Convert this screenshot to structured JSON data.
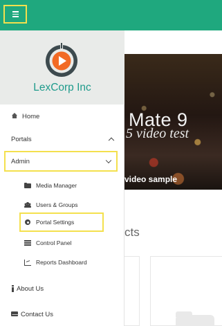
{
  "header": {
    "menu_button": "menu-hamburger-icon",
    "background_color": "#1fa87e"
  },
  "background": {
    "hero_line1": "Mate 9",
    "hero_line2": "5 video test",
    "hero_caption": "video sample",
    "section_title": "cts"
  },
  "drawer": {
    "brand_name": "LexCorp Inc",
    "brand_color": "#1f9b8c",
    "highlight_color": "#f4e04d",
    "items": [
      {
        "label": "Home",
        "icon": "home-icon"
      },
      {
        "label": "Portals",
        "icon": "chevron-up-icon"
      },
      {
        "label": "Admin",
        "icon": "chevron-down-icon"
      },
      {
        "label": "Media Manager",
        "icon": "folder-icon"
      },
      {
        "label": "Users & Groups",
        "icon": "users-icon"
      },
      {
        "label": "Portal Settings",
        "icon": "gear-icon"
      },
      {
        "label": "Control Panel",
        "icon": "list-icon"
      },
      {
        "label": "Reports Dashboard",
        "icon": "chart-icon"
      },
      {
        "label": "About Us",
        "icon": "info-icon"
      },
      {
        "label": "Contact Us",
        "icon": "envelope-icon"
      }
    ]
  }
}
